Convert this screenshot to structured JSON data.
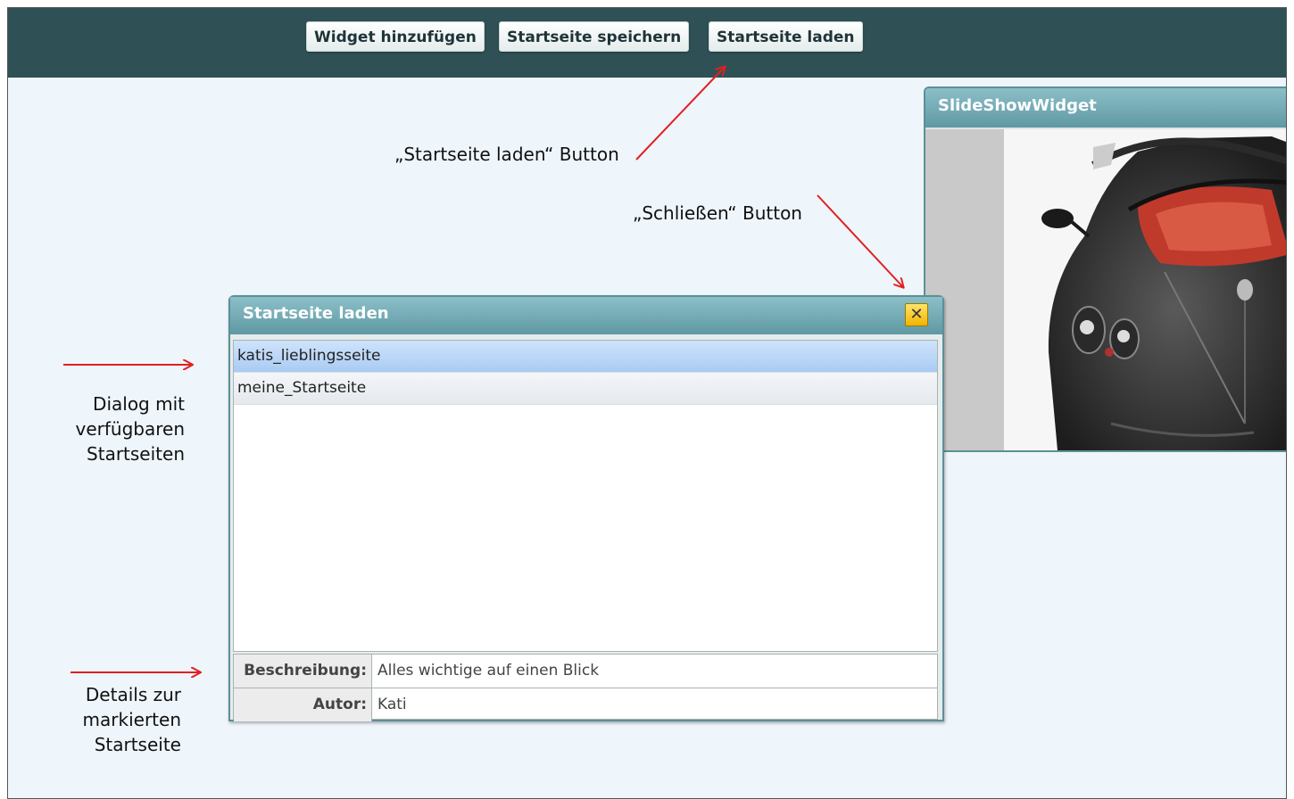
{
  "toolbar": {
    "add_widget": "Widget hinzufügen",
    "save_start_page": "Startseite speichern",
    "load_start_page": "Startseite laden"
  },
  "widget": {
    "title": "SlideShowWidget",
    "image": "sports-car-image"
  },
  "dialog": {
    "title": "Startseite laden",
    "close_icon": "close-icon",
    "items": [
      {
        "label": "katis_lieblingsseite",
        "selected": true
      },
      {
        "label": "meine_Startseite",
        "selected": false
      }
    ],
    "details": {
      "description_label": "Beschreibung:",
      "description_value": "Alles wichtige auf einen Blick",
      "author_label": "Autor:",
      "author_value": "Kati"
    }
  },
  "annotations": {
    "load_button": "„Startseite laden“ Button",
    "close_button": "„Schließen“ Button",
    "dialog": "Dialog mit\nverfügbaren\nStartseiten",
    "details": "Details zur\nmarkierten\nStartseite"
  },
  "colors": {
    "topbar": "#2f5156",
    "header": "#5f99a3",
    "arrow": "#e02020",
    "background": "#eef5fb"
  }
}
